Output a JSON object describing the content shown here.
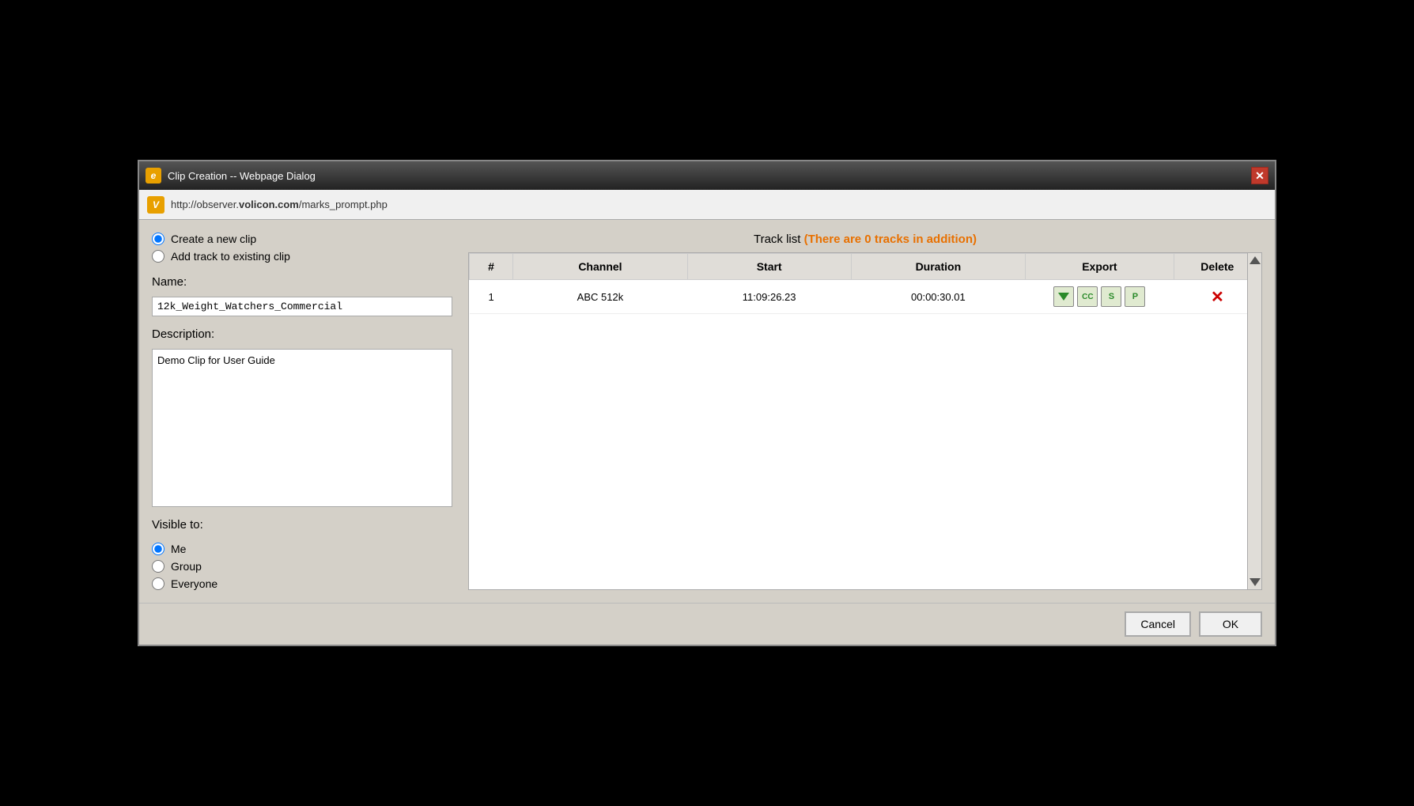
{
  "window": {
    "title": "Clip Creation -- Webpage Dialog",
    "title_icon": "e",
    "close_label": "✕"
  },
  "address_bar": {
    "icon": "V",
    "url_prefix": "http://observer.",
    "url_bold": "volicon.com",
    "url_suffix": "/marks_prompt.php"
  },
  "left_panel": {
    "clip_options": {
      "create_new_label": "Create a new clip",
      "add_track_label": "Add track to existing clip"
    },
    "name_label": "Name:",
    "name_value": "12k_Weight_Watchers_Commercial",
    "description_label": "Description:",
    "description_value": "Demo Clip for User Guide",
    "visible_to_label": "Visible to:",
    "visible_options": [
      {
        "label": "Me",
        "checked": true
      },
      {
        "label": "Group",
        "checked": false
      },
      {
        "label": "Everyone",
        "checked": false
      }
    ]
  },
  "right_panel": {
    "track_list_title": "Track list",
    "track_list_note": "(There are 0 tracks in addition)",
    "table": {
      "columns": [
        "#",
        "Channel",
        "Start",
        "Duration",
        "Export",
        "Delete"
      ],
      "rows": [
        {
          "number": "1",
          "channel": "ABC 512k",
          "start": "11:09:26.23",
          "duration": "00:00:30.01"
        }
      ]
    }
  },
  "footer": {
    "cancel_label": "Cancel",
    "ok_label": "OK"
  }
}
